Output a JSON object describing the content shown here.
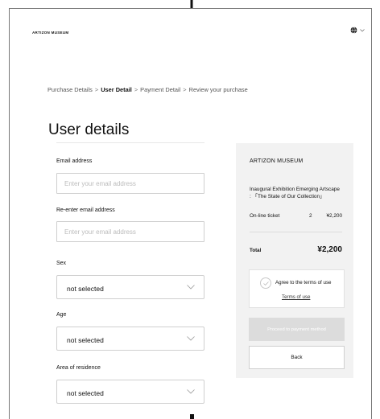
{
  "header": {
    "logo": "ARTIZON MUSEUM",
    "language_icon": "globe-icon"
  },
  "breadcrumb": {
    "steps": [
      "Purchase Details",
      "User Detail",
      "Payment Detail",
      "Review your purchase"
    ],
    "separator": ">"
  },
  "page": {
    "title": "User details"
  },
  "form": {
    "email": {
      "label": "Email address",
      "placeholder": "Enter your email address",
      "value": ""
    },
    "email_confirm": {
      "label": "Re-enter email address",
      "placeholder": "Enter your email address",
      "value": ""
    },
    "sex": {
      "label": "Sex",
      "selected": "not selected"
    },
    "age": {
      "label": "Age",
      "selected": "not selected"
    },
    "residence": {
      "label": "Area of residence",
      "selected": "not selected"
    }
  },
  "summary": {
    "museum": "ARTIZON MUSEUM",
    "exhibition": "Inaugural Exhibition Emerging Artscape : 「The State of Our Collection」",
    "ticket": {
      "name": "On-line ticket",
      "quantity": "2",
      "price": "¥2,200"
    },
    "total_label": "Total",
    "total_value": "¥2,200",
    "terms_text": "Agree to the terms of use",
    "terms_link": "Terms of use",
    "pay_button": "Proceed to payment method",
    "back_button": "Back"
  },
  "colors": {
    "summary_bg": "#f2f2f2",
    "disabled_button": "#dcdcdc",
    "border": "#cfcfcf"
  }
}
